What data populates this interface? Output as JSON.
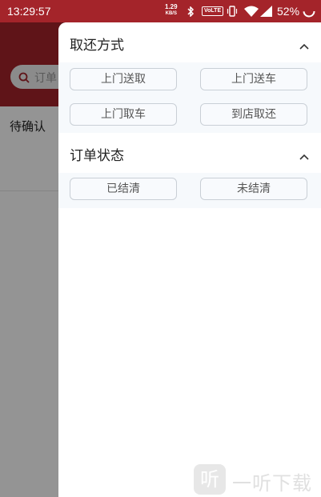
{
  "status_bar": {
    "time": "13:29:57",
    "speed_value": "1.29",
    "speed_unit": "KB/S",
    "volte": "VoLTE",
    "battery_percent": "52%"
  },
  "background_app": {
    "search_placeholder": "订单",
    "tab_label": "待确认"
  },
  "filter_drawer": {
    "sections": [
      {
        "title": "取还方式",
        "options": [
          "上门送取",
          "上门送车",
          "上门取车",
          "到店取还"
        ]
      },
      {
        "title": "订单状态",
        "options": [
          "已结清",
          "未结清"
        ]
      }
    ]
  },
  "watermark": {
    "logo_char": "听",
    "text": "一听下载"
  }
}
